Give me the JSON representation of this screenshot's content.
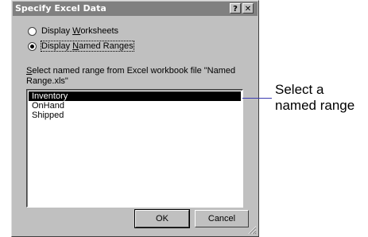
{
  "window": {
    "title": "Specify Excel Data",
    "help_glyph": "?",
    "close_glyph": "✕"
  },
  "options": [
    {
      "label_pre": "Display ",
      "label_key": "W",
      "label_post": "orksheets",
      "selected": false
    },
    {
      "label_pre": "Display ",
      "label_key": "N",
      "label_post": "amed Ranges",
      "selected": true
    }
  ],
  "prompt": {
    "key": "S",
    "text": "elect named range from Excel workbook file \"Named Range.xls\""
  },
  "list": {
    "items": [
      "Inventory",
      "OnHand",
      "Shipped"
    ],
    "selected_index": 0
  },
  "buttons": {
    "ok": "OK",
    "cancel": "Cancel"
  },
  "annotation": {
    "text": "Select a named range",
    "color": "#3b3bb0"
  }
}
